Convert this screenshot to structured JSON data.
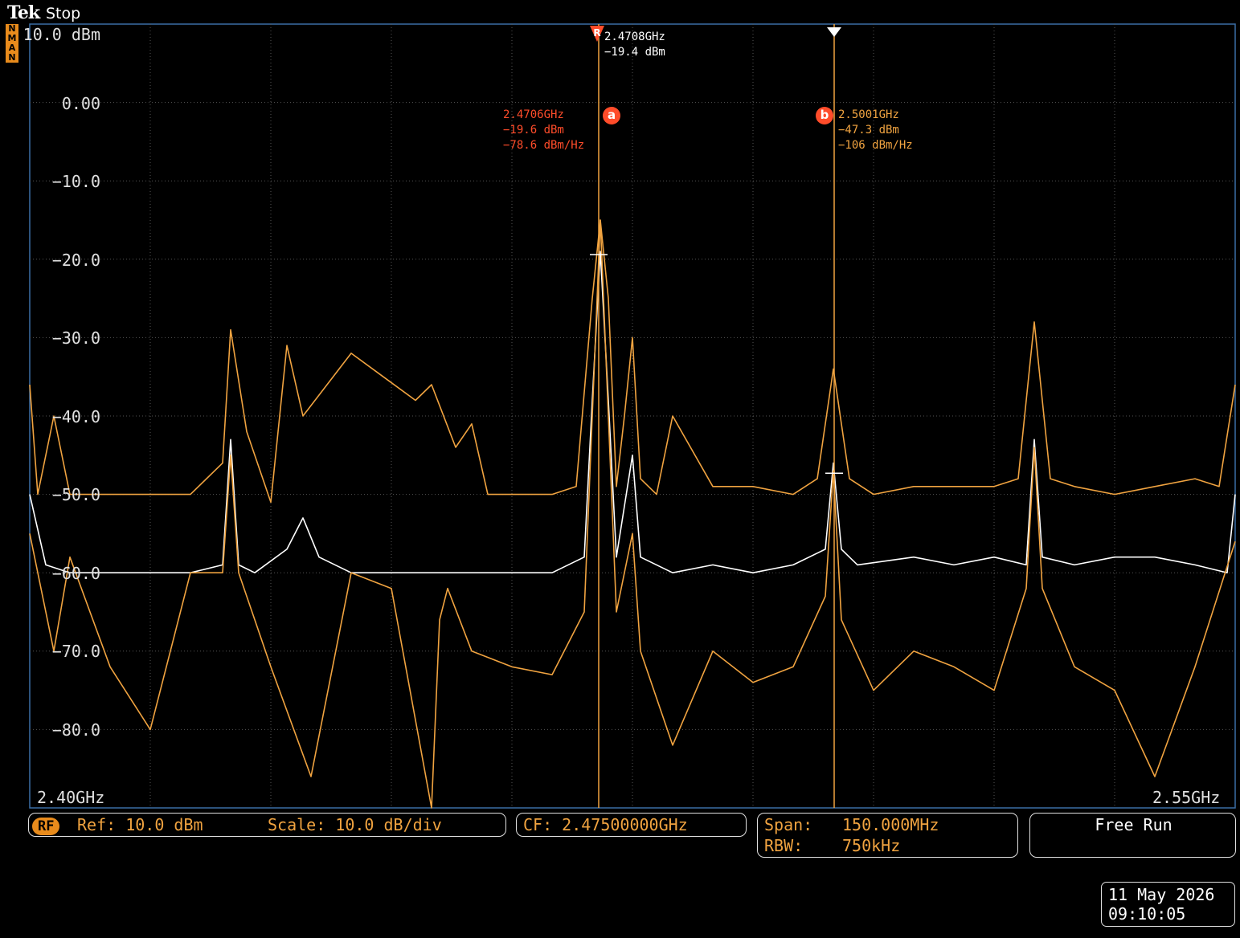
{
  "header": {
    "brand": "Tek",
    "run_state": "Stop"
  },
  "mode_badge": [
    "N",
    "M",
    "A",
    "N"
  ],
  "y_axis": {
    "labels": [
      "10.0 dBm",
      "0.00",
      "−10.0",
      "−20.0",
      "−30.0",
      "−40.0",
      "−50.0",
      "−60.0",
      "−70.0",
      "−80.0"
    ]
  },
  "x_axis": {
    "start_label": "2.40GHz",
    "stop_label": "2.55GHz"
  },
  "ref_marker": {
    "symbol": "R",
    "freq": "2.4708GHz",
    "level": "−19.4 dBm"
  },
  "marker_a": {
    "symbol": "a",
    "freq": "2.4706GHz",
    "level": "−19.6 dBm",
    "density": "−78.6 dBm/Hz"
  },
  "marker_b": {
    "symbol": "b",
    "freq": "2.5001GHz",
    "level": "−47.3 dBm",
    "density": "−106 dBm/Hz"
  },
  "status": {
    "rf_badge": "RF",
    "ref": "Ref: 10.0 dBm",
    "scale": "Scale: 10.0 dB/div",
    "cf": "CF: 2.47500000GHz",
    "span_label": "Span:",
    "span_value": "150.000MHz",
    "rbw_label": "RBW:",
    "rbw_value": "750kHz",
    "trigger": "Free Run"
  },
  "timestamp": {
    "date": "11 May 2026",
    "time": "09:10:05"
  },
  "colors": {
    "trace_orange": "#f0a340",
    "trace_white": "#ffffff",
    "marker_red": "#ff4c2a",
    "grid": "#555555"
  },
  "chart_data": {
    "type": "line",
    "x_unit": "GHz",
    "y_unit": "dBm",
    "xlim": [
      2.4,
      2.55
    ],
    "ylim": [
      -90,
      10
    ],
    "grid": true,
    "series": [
      {
        "color": "#f0a340",
        "style": "max-hold",
        "x": [
          2.4,
          2.401,
          2.403,
          2.405,
          2.41,
          2.42,
          2.424,
          2.425,
          2.427,
          2.43,
          2.432,
          2.434,
          2.44,
          2.444,
          2.448,
          2.45,
          2.453,
          2.455,
          2.457,
          2.46,
          2.465,
          2.468,
          2.47,
          2.471,
          2.472,
          2.473,
          2.474,
          2.475,
          2.476,
          2.478,
          2.48,
          2.485,
          2.49,
          2.495,
          2.498,
          2.5,
          2.502,
          2.505,
          2.51,
          2.515,
          2.52,
          2.523,
          2.525,
          2.527,
          2.53,
          2.535,
          2.54,
          2.545,
          2.548,
          2.55
        ],
        "y": [
          -36,
          -50,
          -40,
          -50,
          -50,
          -50,
          -46,
          -29,
          -42,
          -51,
          -31,
          -40,
          -32,
          -35,
          -38,
          -36,
          -44,
          -41,
          -50,
          -50,
          -50,
          -49,
          -25,
          -15,
          -25,
          -49,
          -40,
          -30,
          -48,
          -50,
          -40,
          -49,
          -49,
          -50,
          -48,
          -34,
          -48,
          -50,
          -49,
          -49,
          -49,
          -48,
          -28,
          -48,
          -49,
          -50,
          -49,
          -48,
          -49,
          -36
        ]
      },
      {
        "color": "#ffffff",
        "style": "average",
        "x": [
          2.4,
          2.402,
          2.405,
          2.41,
          2.415,
          2.42,
          2.424,
          2.425,
          2.426,
          2.428,
          2.432,
          2.434,
          2.436,
          2.44,
          2.445,
          2.45,
          2.455,
          2.46,
          2.465,
          2.469,
          2.47,
          2.471,
          2.472,
          2.473,
          2.475,
          2.476,
          2.48,
          2.485,
          2.49,
          2.495,
          2.499,
          2.5,
          2.501,
          2.503,
          2.51,
          2.515,
          2.52,
          2.524,
          2.525,
          2.526,
          2.53,
          2.535,
          2.54,
          2.545,
          2.549,
          2.55
        ],
        "y": [
          -50,
          -59,
          -60,
          -60,
          -60,
          -60,
          -59,
          -43,
          -59,
          -60,
          -57,
          -53,
          -58,
          -60,
          -60,
          -60,
          -60,
          -60,
          -60,
          -58,
          -38,
          -19,
          -38,
          -58,
          -45,
          -58,
          -60,
          -59,
          -60,
          -59,
          -57,
          -46,
          -57,
          -59,
          -58,
          -59,
          -58,
          -59,
          -43,
          -58,
          -59,
          -58,
          -58,
          -59,
          -60,
          -50
        ]
      },
      {
        "color": "#f0a340",
        "style": "live",
        "x": [
          2.4,
          2.403,
          2.405,
          2.41,
          2.415,
          2.42,
          2.424,
          2.425,
          2.426,
          2.43,
          2.435,
          2.44,
          2.445,
          2.45,
          2.451,
          2.452,
          2.455,
          2.46,
          2.465,
          2.469,
          2.47,
          2.471,
          2.472,
          2.473,
          2.475,
          2.476,
          2.48,
          2.485,
          2.49,
          2.495,
          2.499,
          2.5,
          2.501,
          2.505,
          2.51,
          2.515,
          2.52,
          2.524,
          2.525,
          2.526,
          2.53,
          2.535,
          2.54,
          2.545,
          2.55
        ],
        "y": [
          -55,
          -70,
          -58,
          -72,
          -80,
          -60,
          -60,
          -45,
          -60,
          -72,
          -86,
          -60,
          -62,
          -90,
          -66,
          -62,
          -70,
          -72,
          -73,
          -65,
          -40,
          -15,
          -40,
          -65,
          -55,
          -70,
          -82,
          -70,
          -74,
          -72,
          -63,
          -47,
          -66,
          -75,
          -70,
          -72,
          -75,
          -62,
          -44,
          -62,
          -72,
          -75,
          -86,
          -72,
          -56
        ]
      }
    ]
  }
}
